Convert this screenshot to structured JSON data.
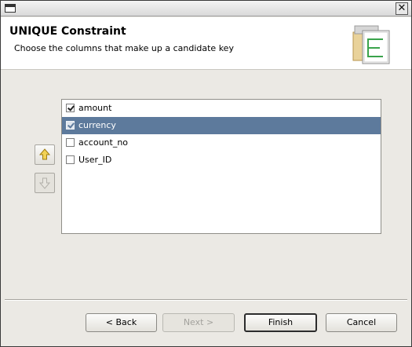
{
  "window": {
    "title": ""
  },
  "banner": {
    "title": "UNIQUE Constraint",
    "subtitle": "Choose the columns that make up a candidate key"
  },
  "columns": [
    {
      "label": "amount",
      "checked": true,
      "selected": false
    },
    {
      "label": "currency",
      "checked": true,
      "selected": true
    },
    {
      "label": "account_no",
      "checked": false,
      "selected": false
    },
    {
      "label": "User_ID",
      "checked": false,
      "selected": false
    }
  ],
  "buttons": {
    "back": "< Back",
    "next": "Next >",
    "finish": "Finish",
    "cancel": "Cancel"
  },
  "colors": {
    "selection": "#5d7a9c",
    "dialog_bg": "#ebe9e4"
  }
}
